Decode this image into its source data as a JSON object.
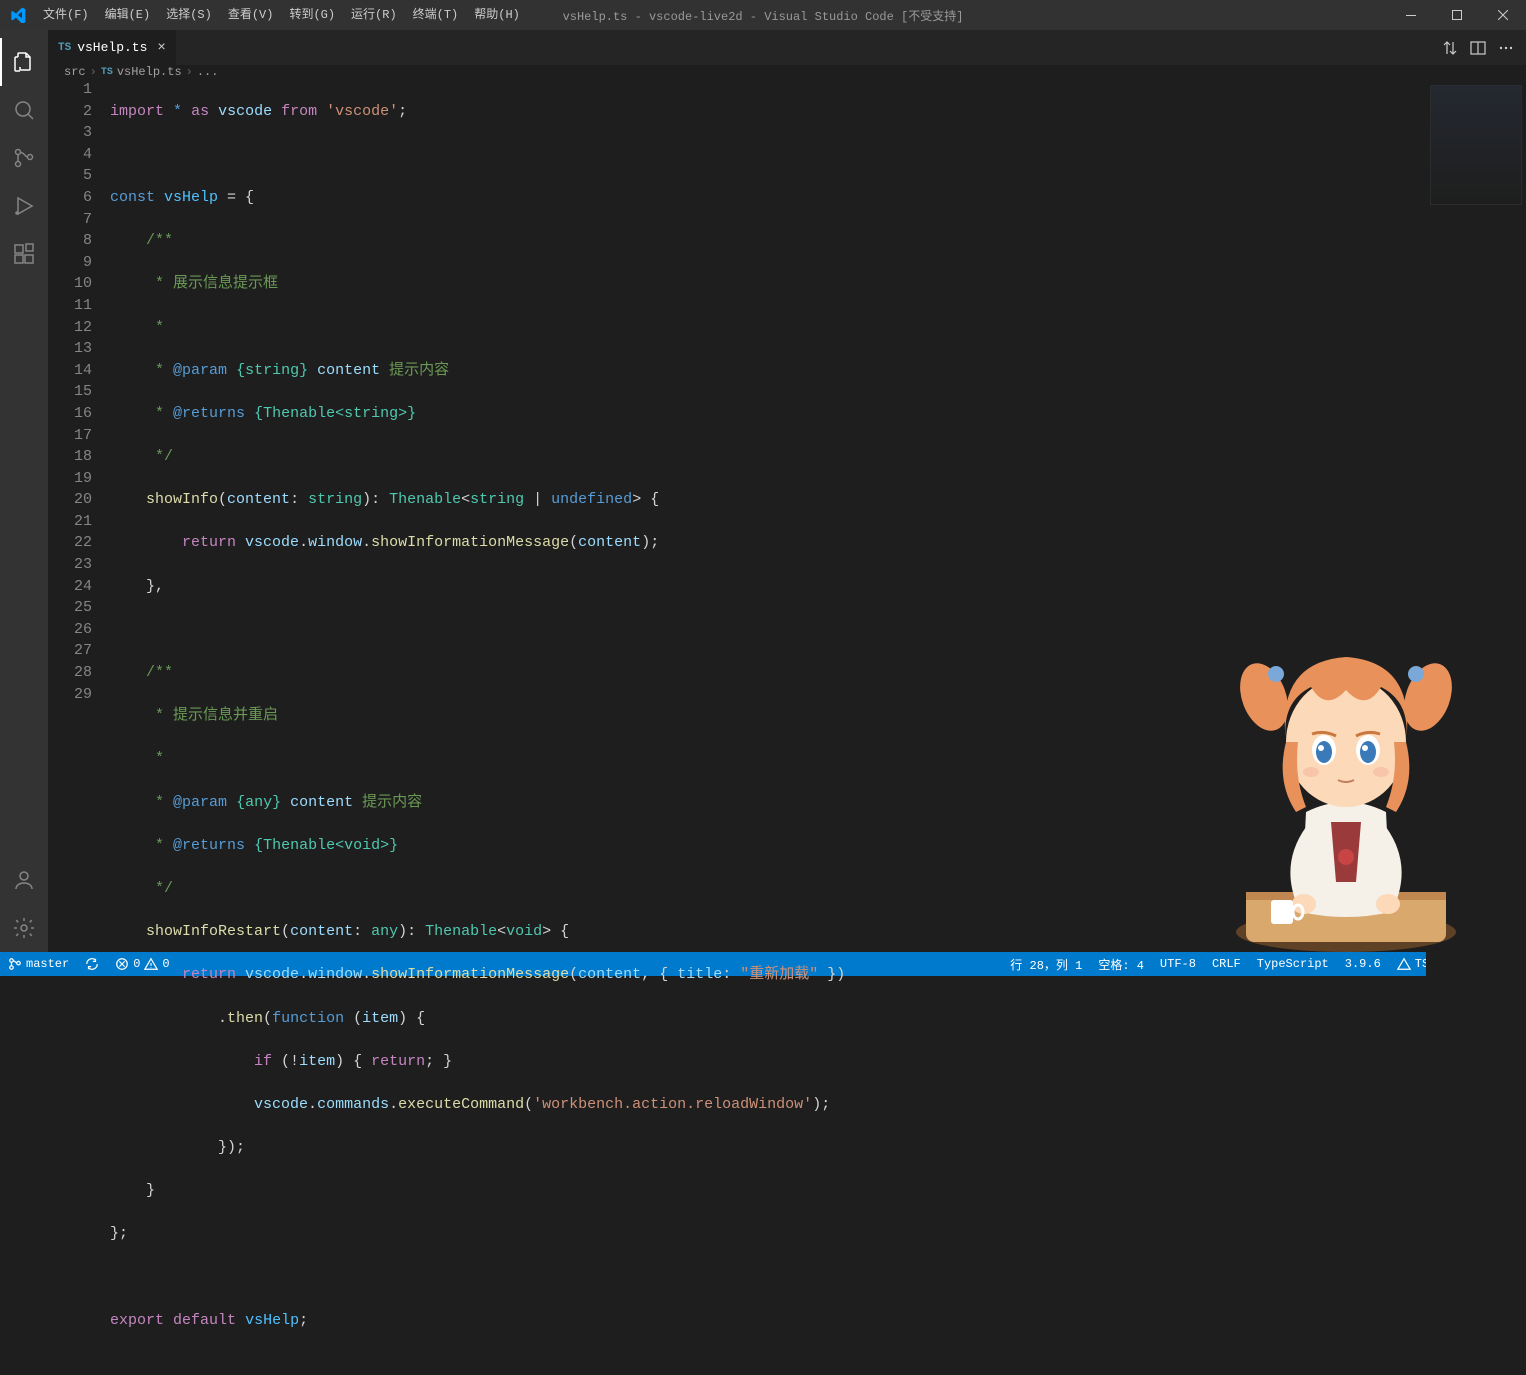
{
  "window": {
    "title": "vsHelp.ts - vscode-live2d - Visual Studio Code [不受支持]"
  },
  "menu": {
    "file": "文件(F)",
    "edit": "编辑(E)",
    "selection": "选择(S)",
    "view": "查看(V)",
    "go": "转到(G)",
    "run": "运行(R)",
    "terminal": "终端(T)",
    "help": "帮助(H)"
  },
  "tab": {
    "icon": "TS",
    "name": "vsHelp.ts"
  },
  "breadcrumb": {
    "folder": "src",
    "icon": "TS",
    "file": "vsHelp.ts",
    "more": "..."
  },
  "statusbar": {
    "branch": "master",
    "errors": "0",
    "warnings": "0",
    "cursor": "行 28，列 1",
    "spaces": "空格: 4",
    "encoding": "UTF-8",
    "eol": "CRLF",
    "lang": "TypeScript",
    "tsver": "3.9.6",
    "lint": "TSLint"
  },
  "code": {
    "lineNumbers": [
      "1",
      "2",
      "3",
      "4",
      "5",
      "6",
      "7",
      "8",
      "9",
      "10",
      "11",
      "12",
      "13",
      "14",
      "15",
      "16",
      "17",
      "18",
      "19",
      "20",
      "21",
      "22",
      "23",
      "24",
      "25",
      "26",
      "27",
      "28",
      "29"
    ]
  }
}
